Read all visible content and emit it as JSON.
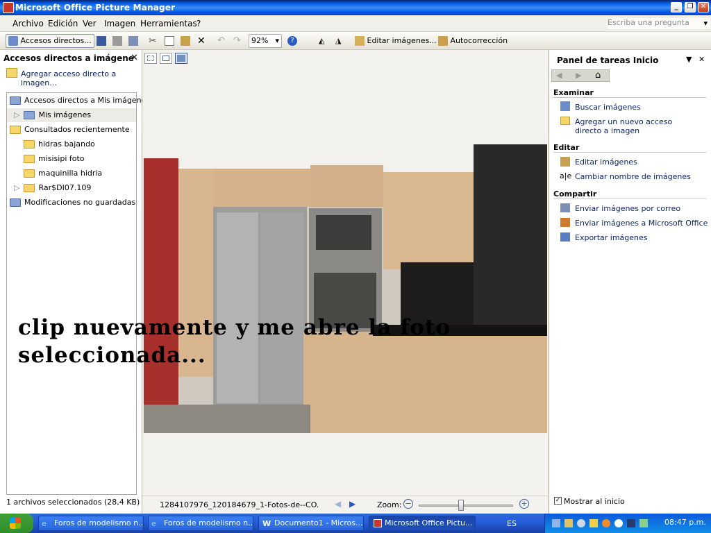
{
  "window": {
    "title": "Microsoft Office Picture Manager"
  },
  "menus": [
    "Archivo",
    "Edición",
    "Ver",
    "Imagen",
    "Herramientas",
    "?"
  ],
  "help_box": {
    "placeholder": "Escriba una pregunta"
  },
  "toolbar": {
    "shortcuts_label": "Accesos directos...",
    "zoom_value": "92%",
    "edit_images_label": "Editar imágenes...",
    "autocorrect_label": "Autocorrección"
  },
  "left_pane": {
    "header": "Accesos directos a imágene",
    "add_shortcut_link": "Agregar acceso directo a imagen...",
    "tree": [
      {
        "label": "Accesos directos a Mis imágenes"
      },
      {
        "label": "Mis imágenes"
      },
      {
        "label": "Consultados recientemente"
      },
      {
        "label": "hidras bajando"
      },
      {
        "label": "misisipi foto"
      },
      {
        "label": "maquinilla hidria"
      },
      {
        "label": "Rar$DI07.109"
      },
      {
        "label": "Modificaciones no guardadas"
      }
    ]
  },
  "photo": {
    "overlay_text": "clip nuevamente y me abre la foto seleccionada...",
    "filename": "1284107976_120184679_1-Fotos-de--CO..."
  },
  "zoom": {
    "label": "Zoom:",
    "slider_level": 0.45
  },
  "right_pane": {
    "header": "Panel de tareas Inicio",
    "sections": [
      {
        "title": "Examinar",
        "links": [
          "Buscar imágenes",
          "Agregar un nuevo acceso directo a imagen"
        ]
      },
      {
        "title": "Editar",
        "links": [
          "Editar imágenes",
          "Cambiar nombre de imágenes"
        ]
      },
      {
        "title": "Compartir",
        "links": [
          "Enviar imágenes por correo",
          "Enviar imágenes a Microsoft Office",
          "Exportar imágenes"
        ]
      }
    ],
    "show_on_start": "Mostrar al inicio"
  },
  "status": {
    "selection": "1 archivos seleccionados (28,4 KB)"
  },
  "taskbar": {
    "tasks": [
      "Foros de modelismo n...",
      "Foros de modelismo n...",
      "Documento1 - Micros...",
      "Microsoft Office Pictu..."
    ],
    "language": "ES",
    "clock": "08:47 p.m."
  },
  "colors": {
    "link": "#0a246a",
    "title_bar": "#0058e6",
    "taskbar": "#245edb"
  }
}
